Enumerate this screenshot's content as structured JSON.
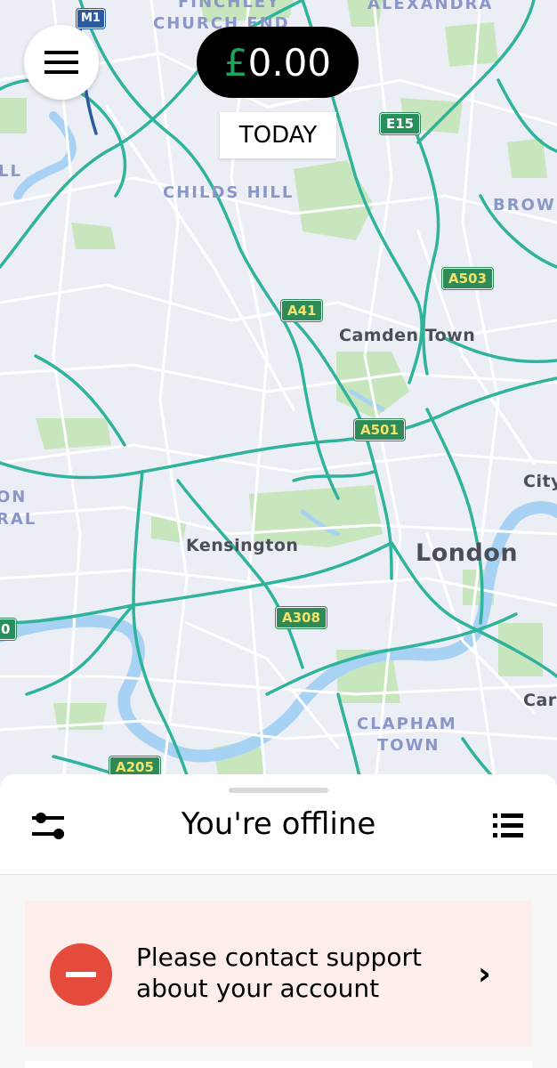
{
  "map": {
    "district_labels": [
      {
        "id": "finchley",
        "text": "FINCHLEY"
      },
      {
        "id": "church-end",
        "text": "CHURCH END"
      },
      {
        "id": "alexandra",
        "text": "ALEXANDRA"
      },
      {
        "id": "childs-hill",
        "text": "CHILDS HILL"
      },
      {
        "id": "brow",
        "text": "BROW"
      },
      {
        "id": "ll",
        "text": "LL"
      },
      {
        "id": "on",
        "text": "ON"
      },
      {
        "id": "ral",
        "text": "RAL"
      },
      {
        "id": "clapham",
        "text": "CLAPHAM"
      },
      {
        "id": "town",
        "text": "TOWN"
      }
    ],
    "place_labels": [
      {
        "id": "camden-town",
        "text": "Camden Town"
      },
      {
        "id": "kensington",
        "text": "Kensington"
      },
      {
        "id": "city",
        "text": "City"
      },
      {
        "id": "car",
        "text": "Car"
      }
    ],
    "city_label": "London",
    "road_shields": [
      {
        "id": "m1",
        "text": "M1",
        "style": "motorway"
      },
      {
        "id": "e15",
        "text": "E15",
        "style": "e-road"
      },
      {
        "id": "a503",
        "text": "A503",
        "style": "a-road"
      },
      {
        "id": "a41",
        "text": "A41",
        "style": "a-road"
      },
      {
        "id": "a501",
        "text": "A501",
        "style": "a-road"
      },
      {
        "id": "a308",
        "text": "A308",
        "style": "a-road"
      },
      {
        "id": "a205",
        "text": "A205",
        "style": "a-road"
      },
      {
        "id": "edge-o",
        "text": "0",
        "style": "e-road"
      }
    ]
  },
  "header": {
    "menu_icon": "hamburger-menu-icon",
    "earnings": {
      "currency": "£",
      "amount": "0.00"
    },
    "period": "TODAY"
  },
  "sheet": {
    "title": "You're offline",
    "left_icon": "preferences-sliders-icon",
    "right_icon": "list-icon",
    "alert": {
      "icon": "no-entry-icon",
      "line1": "Please contact support",
      "line2": "about your account",
      "chevron": "›"
    }
  },
  "colors": {
    "map_background": "#eceef6",
    "main_roads": "#2fb39a",
    "parks": "#bfe1b5",
    "water": "#a9d3f5",
    "earnings_currency": "#1fa55a",
    "alert_background": "#fdeeeb",
    "alert_icon": "#e54b3c"
  }
}
